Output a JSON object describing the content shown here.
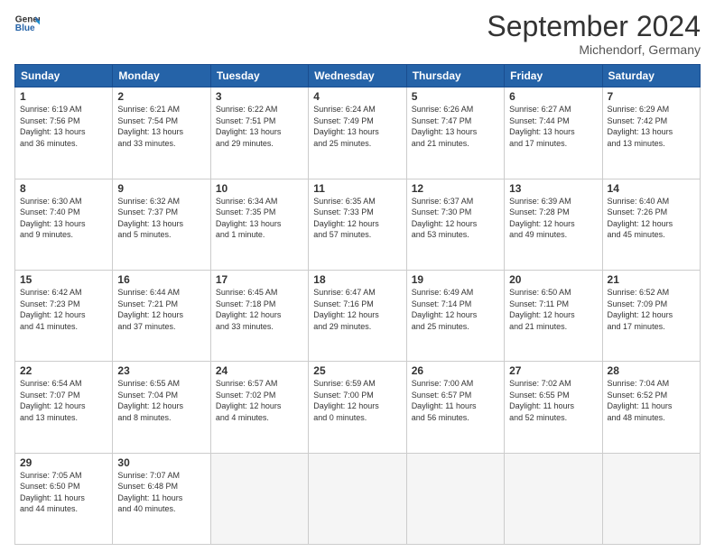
{
  "header": {
    "logo_line1": "General",
    "logo_line2": "Blue",
    "month": "September 2024",
    "location": "Michendorf, Germany"
  },
  "days_of_week": [
    "Sunday",
    "Monday",
    "Tuesday",
    "Wednesday",
    "Thursday",
    "Friday",
    "Saturday"
  ],
  "weeks": [
    [
      {
        "day": "1",
        "info": "Sunrise: 6:19 AM\nSunset: 7:56 PM\nDaylight: 13 hours\nand 36 minutes."
      },
      {
        "day": "2",
        "info": "Sunrise: 6:21 AM\nSunset: 7:54 PM\nDaylight: 13 hours\nand 33 minutes."
      },
      {
        "day": "3",
        "info": "Sunrise: 6:22 AM\nSunset: 7:51 PM\nDaylight: 13 hours\nand 29 minutes."
      },
      {
        "day": "4",
        "info": "Sunrise: 6:24 AM\nSunset: 7:49 PM\nDaylight: 13 hours\nand 25 minutes."
      },
      {
        "day": "5",
        "info": "Sunrise: 6:26 AM\nSunset: 7:47 PM\nDaylight: 13 hours\nand 21 minutes."
      },
      {
        "day": "6",
        "info": "Sunrise: 6:27 AM\nSunset: 7:44 PM\nDaylight: 13 hours\nand 17 minutes."
      },
      {
        "day": "7",
        "info": "Sunrise: 6:29 AM\nSunset: 7:42 PM\nDaylight: 13 hours\nand 13 minutes."
      }
    ],
    [
      {
        "day": "8",
        "info": "Sunrise: 6:30 AM\nSunset: 7:40 PM\nDaylight: 13 hours\nand 9 minutes."
      },
      {
        "day": "9",
        "info": "Sunrise: 6:32 AM\nSunset: 7:37 PM\nDaylight: 13 hours\nand 5 minutes."
      },
      {
        "day": "10",
        "info": "Sunrise: 6:34 AM\nSunset: 7:35 PM\nDaylight: 13 hours\nand 1 minute."
      },
      {
        "day": "11",
        "info": "Sunrise: 6:35 AM\nSunset: 7:33 PM\nDaylight: 12 hours\nand 57 minutes."
      },
      {
        "day": "12",
        "info": "Sunrise: 6:37 AM\nSunset: 7:30 PM\nDaylight: 12 hours\nand 53 minutes."
      },
      {
        "day": "13",
        "info": "Sunrise: 6:39 AM\nSunset: 7:28 PM\nDaylight: 12 hours\nand 49 minutes."
      },
      {
        "day": "14",
        "info": "Sunrise: 6:40 AM\nSunset: 7:26 PM\nDaylight: 12 hours\nand 45 minutes."
      }
    ],
    [
      {
        "day": "15",
        "info": "Sunrise: 6:42 AM\nSunset: 7:23 PM\nDaylight: 12 hours\nand 41 minutes."
      },
      {
        "day": "16",
        "info": "Sunrise: 6:44 AM\nSunset: 7:21 PM\nDaylight: 12 hours\nand 37 minutes."
      },
      {
        "day": "17",
        "info": "Sunrise: 6:45 AM\nSunset: 7:18 PM\nDaylight: 12 hours\nand 33 minutes."
      },
      {
        "day": "18",
        "info": "Sunrise: 6:47 AM\nSunset: 7:16 PM\nDaylight: 12 hours\nand 29 minutes."
      },
      {
        "day": "19",
        "info": "Sunrise: 6:49 AM\nSunset: 7:14 PM\nDaylight: 12 hours\nand 25 minutes."
      },
      {
        "day": "20",
        "info": "Sunrise: 6:50 AM\nSunset: 7:11 PM\nDaylight: 12 hours\nand 21 minutes."
      },
      {
        "day": "21",
        "info": "Sunrise: 6:52 AM\nSunset: 7:09 PM\nDaylight: 12 hours\nand 17 minutes."
      }
    ],
    [
      {
        "day": "22",
        "info": "Sunrise: 6:54 AM\nSunset: 7:07 PM\nDaylight: 12 hours\nand 13 minutes."
      },
      {
        "day": "23",
        "info": "Sunrise: 6:55 AM\nSunset: 7:04 PM\nDaylight: 12 hours\nand 8 minutes."
      },
      {
        "day": "24",
        "info": "Sunrise: 6:57 AM\nSunset: 7:02 PM\nDaylight: 12 hours\nand 4 minutes."
      },
      {
        "day": "25",
        "info": "Sunrise: 6:59 AM\nSunset: 7:00 PM\nDaylight: 12 hours\nand 0 minutes."
      },
      {
        "day": "26",
        "info": "Sunrise: 7:00 AM\nSunset: 6:57 PM\nDaylight: 11 hours\nand 56 minutes."
      },
      {
        "day": "27",
        "info": "Sunrise: 7:02 AM\nSunset: 6:55 PM\nDaylight: 11 hours\nand 52 minutes."
      },
      {
        "day": "28",
        "info": "Sunrise: 7:04 AM\nSunset: 6:52 PM\nDaylight: 11 hours\nand 48 minutes."
      }
    ],
    [
      {
        "day": "29",
        "info": "Sunrise: 7:05 AM\nSunset: 6:50 PM\nDaylight: 11 hours\nand 44 minutes."
      },
      {
        "day": "30",
        "info": "Sunrise: 7:07 AM\nSunset: 6:48 PM\nDaylight: 11 hours\nand 40 minutes."
      },
      {
        "day": "",
        "info": ""
      },
      {
        "day": "",
        "info": ""
      },
      {
        "day": "",
        "info": ""
      },
      {
        "day": "",
        "info": ""
      },
      {
        "day": "",
        "info": ""
      }
    ]
  ]
}
